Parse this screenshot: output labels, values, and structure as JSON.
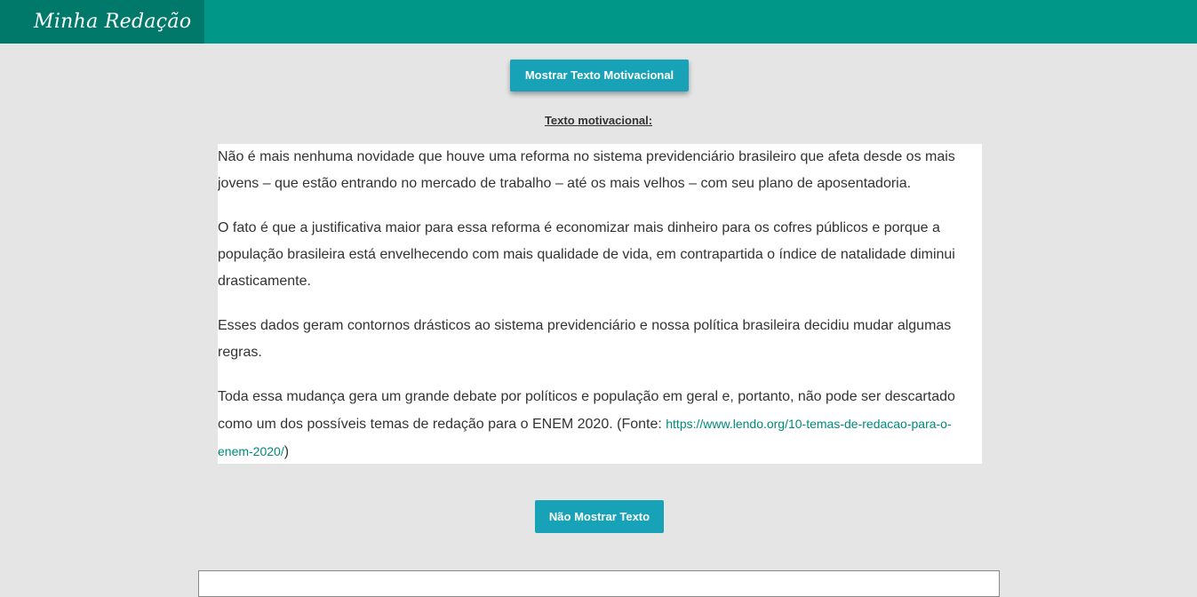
{
  "header": {
    "brand": "Minha Redação"
  },
  "buttons": {
    "show_text": "Mostrar Texto Motivacional",
    "hide_text": "Não Mostrar Texto"
  },
  "motivational": {
    "heading": "Texto motivacional:",
    "paragraphs": [
      "Não é mais nenhuma novidade que houve uma reforma no sistema previdenciário brasileiro que afeta desde os mais jovens – que estão entrando no mercado de trabalho – até os mais velhos – com seu plano de aposentadoria.",
      "O fato é que a justificativa maior para essa reforma é economizar mais dinheiro para os cofres públicos e porque a população brasileira está envelhecendo com mais qualidade de vida, em contrapartida o índice de natalidade diminui drasticamente.",
      "Esses dados geram contornos drásticos ao sistema previdenciário e nossa política brasileira decidiu mudar algumas regras.",
      "Toda essa mudança gera um grande debate por políticos e população em geral e, portanto, não pode ser descartado como um dos possíveis temas de redação para o ENEM 2020. (Fonte: "
    ],
    "source_link": "https://www.lendo.org/10-temas-de-redacao-para-o-enem-2020/",
    "source_close": ")"
  },
  "colors": {
    "header_bg": "#009688",
    "brand_bg": "#00796b",
    "button_bg": "#17a2b8",
    "page_bg": "#e5e5e5",
    "link": "#00897b"
  }
}
